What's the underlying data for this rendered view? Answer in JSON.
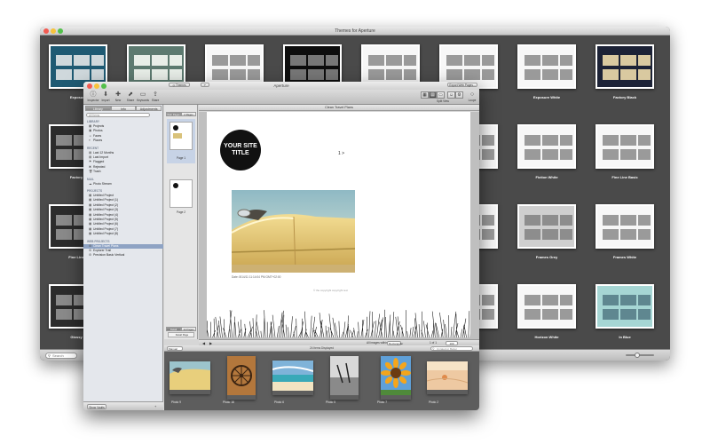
{
  "themes_window": {
    "title": "Themes for Aperture",
    "search_placeholder": "Search",
    "themes": [
      {
        "label": "Exposure",
        "variant": "teal"
      },
      {
        "label": "",
        "variant": "sage"
      },
      {
        "label": "",
        "variant": "white-grid"
      },
      {
        "label": "",
        "variant": "black"
      },
      {
        "label": "",
        "variant": "white-grid"
      },
      {
        "label": "",
        "variant": "white-grid"
      },
      {
        "label": "Exposure White",
        "variant": "white-grid"
      },
      {
        "label": "Factory Black",
        "variant": "navy"
      },
      {
        "label": "Factory C",
        "variant": "dark"
      },
      {
        "label": "",
        "variant": "white-grid"
      },
      {
        "label": "",
        "variant": "white-grid"
      },
      {
        "label": "",
        "variant": "white-grid"
      },
      {
        "label": "",
        "variant": "white-grid"
      },
      {
        "label": "",
        "variant": "white-grid"
      },
      {
        "label": "Fiction White",
        "variant": "white-grid"
      },
      {
        "label": "Fine Line Basic",
        "variant": "white-grid"
      },
      {
        "label": "Fine Line B",
        "variant": "dark"
      },
      {
        "label": "",
        "variant": "white-grid"
      },
      {
        "label": "",
        "variant": "white-grid"
      },
      {
        "label": "",
        "variant": "white-grid"
      },
      {
        "label": "",
        "variant": "white-grid"
      },
      {
        "label": "",
        "variant": "white-grid"
      },
      {
        "label": "Frames Grey",
        "variant": "grey"
      },
      {
        "label": "Frames White",
        "variant": "white-grid"
      },
      {
        "label": "Glossy B",
        "variant": "dark"
      },
      {
        "label": "",
        "variant": "white-grid"
      },
      {
        "label": "",
        "variant": "white-grid"
      },
      {
        "label": "",
        "variant": "white-grid"
      },
      {
        "label": "",
        "variant": "white-grid"
      },
      {
        "label": "",
        "variant": "white-grid"
      },
      {
        "label": "Horizon White",
        "variant": "white-grid"
      },
      {
        "label": "In Blue",
        "variant": "aqua"
      }
    ]
  },
  "aperture_window": {
    "title": "Aperture",
    "toolbar": {
      "left": [
        {
          "label": "Inspector",
          "icon": "info-icon",
          "glyph": "ⓘ"
        },
        {
          "label": "Import",
          "icon": "import-icon",
          "glyph": "⬇"
        },
        {
          "label": "New",
          "icon": "new-icon",
          "glyph": "✚"
        },
        {
          "label": "Share",
          "icon": "share-icon",
          "glyph": "⬈"
        },
        {
          "label": "Keywords",
          "icon": "keywords-icon",
          "glyph": "▭"
        },
        {
          "label": "Share",
          "icon": "share-icon",
          "glyph": "⇪"
        }
      ],
      "split_view_label": "Split View",
      "loupe_label": "Loupe"
    },
    "sidebar": {
      "tabs": [
        "Library",
        "Info",
        "Adjustments"
      ],
      "search_placeholder": "All Items",
      "sections": [
        {
          "heading": "LIBRARY",
          "items": [
            {
              "label": "Projects",
              "glyph": "▦"
            },
            {
              "label": "Photos",
              "glyph": "▣"
            },
            {
              "label": "Faces",
              "glyph": "☺"
            },
            {
              "label": "Places",
              "glyph": "⌖"
            }
          ]
        },
        {
          "heading": "RECENT",
          "items": [
            {
              "label": "Last 12 Months",
              "glyph": "▤"
            },
            {
              "label": "Last Import",
              "glyph": "▤"
            },
            {
              "label": "Flagged",
              "glyph": "⚑"
            },
            {
              "label": "Rejected",
              "glyph": "✖"
            },
            {
              "label": "Trash",
              "glyph": "🗑"
            }
          ]
        },
        {
          "heading": "MAIL",
          "items": [
            {
              "label": "Photo Stream",
              "glyph": "☁"
            }
          ]
        },
        {
          "heading": "PROJECTS",
          "items": [
            {
              "label": "Untitled Project",
              "glyph": "▦"
            },
            {
              "label": "Untitled Project (1)",
              "glyph": "▦"
            },
            {
              "label": "Untitled Project (2)",
              "glyph": "▦"
            },
            {
              "label": "Untitled Project (3)",
              "glyph": "▦"
            },
            {
              "label": "Untitled Project (4)",
              "glyph": "▦"
            },
            {
              "label": "Untitled Project (5)",
              "glyph": "▦"
            },
            {
              "label": "Untitled Project (6)",
              "glyph": "▦"
            },
            {
              "label": "Untitled Project (7)",
              "glyph": "▦"
            },
            {
              "label": "Untitled Project (8)",
              "glyph": "▦"
            }
          ]
        },
        {
          "heading": "WEB PROJECTS",
          "items": [
            {
              "label": "Clean Travel Plans",
              "glyph": "⚙",
              "selected": true
            },
            {
              "label": "Explorer Trail",
              "glyph": "⚙"
            },
            {
              "label": "Precision Basic Vertical",
              "glyph": "⚙"
            }
          ]
        }
      ],
      "show_vaults_label": "Show Vaults"
    },
    "pages_panel": {
      "tabs": [
        "Web Pages",
        "2 Pages"
      ],
      "pages": [
        "Page 1",
        "Page 2"
      ],
      "master_tabs": [
        "Detail",
        "24 Pages"
      ],
      "master_label": "Detail Page"
    },
    "canvas": {
      "title": "Clean Travel Plans",
      "themes_button": "Themes",
      "export_button": "Export Web Pages...",
      "site_title": "YOUR SITE TITLE",
      "page_nav": "1 >",
      "photo_caption": "Date: 8/14/11 11:14:04 PM GMT+02:00",
      "footer_text": "© the copyright copyright text",
      "images_label": "All images within:",
      "sort_value": "Rectangular",
      "page_of": "1 of 1",
      "zoom_value": "100"
    },
    "browser": {
      "sort_value": "Manual",
      "count_label": "24 Items Displayed",
      "search_placeholder": "Unrated or Better",
      "photos": [
        {
          "label": "Photo 9",
          "kind": "car"
        },
        {
          "label": "Photo 18",
          "kind": "wheel"
        },
        {
          "label": "Photo 6",
          "kind": "beach"
        },
        {
          "label": "Photo 5",
          "kind": "bw"
        },
        {
          "label": "Photo 7",
          "kind": "sunflower"
        },
        {
          "label": "Photo 2",
          "kind": "sand"
        }
      ]
    }
  }
}
